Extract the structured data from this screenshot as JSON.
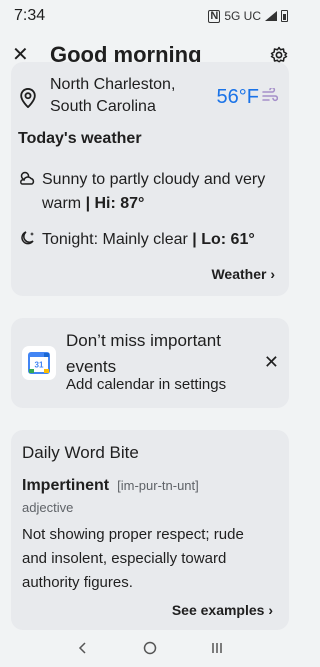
{
  "status": {
    "time": "7:34",
    "network": "5G UC",
    "nfc": "N"
  },
  "header": {
    "title": "Good morning"
  },
  "weather": {
    "location": "North Charleston, South Carolina",
    "temperature": "56°F",
    "section_title": "Today's weather",
    "day_text": "Sunny to partly cloudy and very warm",
    "day_hi": "| Hi: 87°",
    "night_text": "Tonight: Mainly clear",
    "night_lo": "| Lo: 61°",
    "link": "Weather ›",
    "accent": "#1a73e8"
  },
  "calendar": {
    "title": "Don’t miss important events",
    "subtitle": "Add calendar in settings",
    "date": "31"
  },
  "word": {
    "title": "Daily Word Bite",
    "term": "Impertinent",
    "pronunciation": "[im-pur-tn-unt]",
    "part_of_speech": "adjective",
    "definition": "Not showing proper respect; rude and insolent, especially toward authority figures.",
    "link": "See examples ›"
  }
}
